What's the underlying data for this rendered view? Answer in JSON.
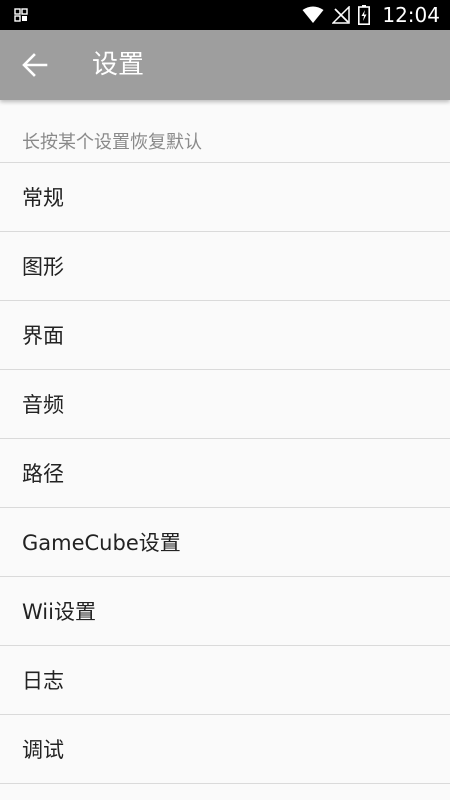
{
  "status_bar": {
    "time": "12:04",
    "icons": [
      "notification-grid-icon",
      "wifi-icon",
      "no-signal-icon",
      "battery-charging-icon"
    ]
  },
  "toolbar": {
    "back_icon": "arrow-left-icon",
    "title": "设置"
  },
  "hint": "长按某个设置恢复默认",
  "menu": {
    "items": [
      {
        "label": "常规"
      },
      {
        "label": "图形"
      },
      {
        "label": "界面"
      },
      {
        "label": "音频"
      },
      {
        "label": "路径"
      },
      {
        "label": "GameCube设置"
      },
      {
        "label": "Wii设置"
      },
      {
        "label": "日志"
      },
      {
        "label": "调试"
      }
    ]
  },
  "colors": {
    "toolbar_bg": "#9e9e9e",
    "page_bg": "#fafafa",
    "divider": "#dadada",
    "hint_text": "#8a8a8a"
  }
}
